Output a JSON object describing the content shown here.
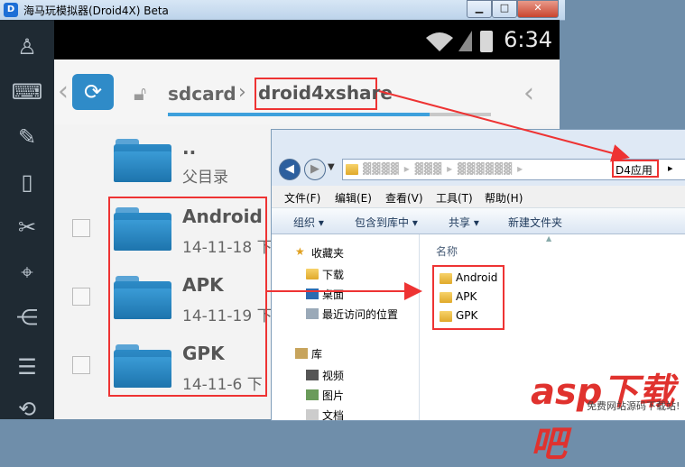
{
  "emulator": {
    "window_title": "海马玩模拟器(Droid4X) Beta",
    "logo_text": "D",
    "btn_min": "▁",
    "btn_max": "□",
    "btn_close": "✕",
    "sidebar_icons": [
      "joystick-icon",
      "keyboard-icon",
      "tools-icon",
      "phone-shake-icon",
      "screen-capture-icon",
      "location-icon",
      "share-icon",
      "menu-icon",
      "rotate-icon"
    ]
  },
  "android": {
    "clock": "6:34",
    "breadcrumb": {
      "root": "sdcard",
      "sep": "›",
      "current": "droid4xshare"
    },
    "back_left": "‹",
    "back_right": "‹",
    "parent_folder": {
      "name": "..",
      "label": "父目录"
    },
    "files": [
      {
        "name": "Android",
        "date": "14-11-18 下"
      },
      {
        "name": "APK",
        "date": "14-11-19 下"
      },
      {
        "name": "GPK",
        "date": "14-11-6 下"
      }
    ]
  },
  "explorer": {
    "address_last": "D4应用",
    "address_sep": "▸",
    "address_blurred": "▓▓▓▓ ▸ ▓▓▓ ▸ ▓▓▓▓▓▓ ▸",
    "menu": [
      "文件(F)",
      "编辑(E)",
      "查看(V)",
      "工具(T)",
      "帮助(H)"
    ],
    "toolbar": [
      "组织 ▾",
      "包含到库中 ▾",
      "共享 ▾",
      "新建文件夹"
    ],
    "nav": {
      "favorites": "收藏夹",
      "fav_items": [
        "下载",
        "桌面",
        "最近访问的位置"
      ],
      "library": "库",
      "lib_items": [
        "视频",
        "图片",
        "文档"
      ]
    },
    "column_header": "名称",
    "files": [
      "Android",
      "APK",
      "GPK"
    ]
  },
  "watermark": {
    "main": "asp下载吧",
    "sub": "免费网站源码下载站!"
  },
  "colors": {
    "highlight_box": "#e33333",
    "folder_blue": "#2c8ac6",
    "android_bg": "#f3f3f3"
  }
}
